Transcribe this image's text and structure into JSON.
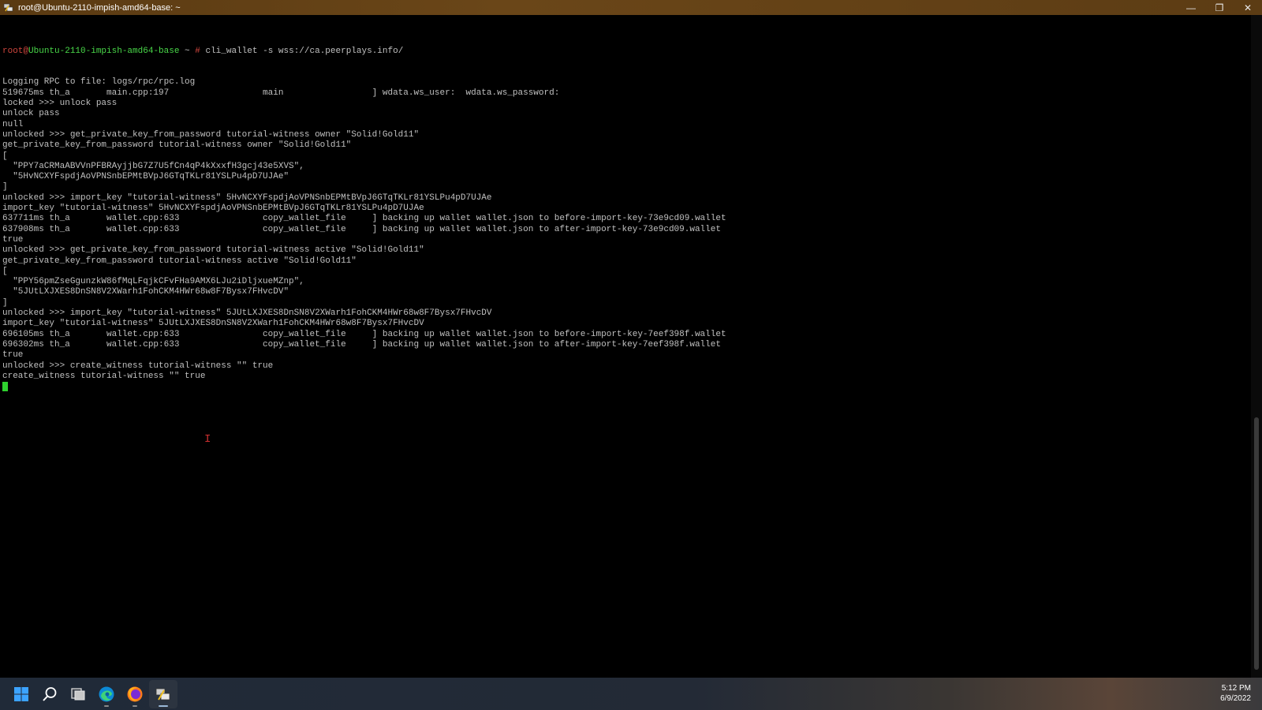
{
  "window": {
    "title": "root@Ubuntu-2110-impish-amd64-base: ~",
    "controls": {
      "minimize": "—",
      "maximize": "❐",
      "close": "✕"
    }
  },
  "prompt": {
    "user": "root",
    "at": "@",
    "host": "Ubuntu-2110-impish-amd64-base",
    "path": " ~ ",
    "symbol": "#",
    "command": " cli_wallet -s wss://ca.peerplays.info/"
  },
  "terminal_lines": [
    "Logging RPC to file: logs/rpc/rpc.log",
    "519675ms th_a       main.cpp:197                  main                 ] wdata.ws_user:  wdata.ws_password:",
    "locked >>> unlock pass",
    "unlock pass",
    "null",
    "unlocked >>> get_private_key_from_password tutorial-witness owner \"Solid!Gold11\"",
    "get_private_key_from_password tutorial-witness owner \"Solid!Gold11\"",
    "[",
    "  \"PPY7aCRMaABVVnPFBRAyjjbG7Z7U5fCn4qP4kXxxfH3gcj43e5XVS\",",
    "  \"5HvNCXYFspdjAoVPNSnbEPMtBVpJ6GTqTKLr81YSLPu4pD7UJAe\"",
    "]",
    "unlocked >>> import_key \"tutorial-witness\" 5HvNCXYFspdjAoVPNSnbEPMtBVpJ6GTqTKLr81YSLPu4pD7UJAe",
    "import_key \"tutorial-witness\" 5HvNCXYFspdjAoVPNSnbEPMtBVpJ6GTqTKLr81YSLPu4pD7UJAe",
    "637711ms th_a       wallet.cpp:633                copy_wallet_file     ] backing up wallet wallet.json to before-import-key-73e9cd09.wallet",
    "637908ms th_a       wallet.cpp:633                copy_wallet_file     ] backing up wallet wallet.json to after-import-key-73e9cd09.wallet",
    "true",
    "unlocked >>> get_private_key_from_password tutorial-witness active \"Solid!Gold11\"",
    "get_private_key_from_password tutorial-witness active \"Solid!Gold11\"",
    "[",
    "  \"PPY56pmZseGgunzkW86fMqLFqjkCFvFHa9AMX6LJu2iDljxueMZnp\",",
    "  \"5JUtLXJXES8DnSN8V2XWarh1FohCKM4HWr68w8F7Bysx7FHvcDV\"",
    "]",
    "unlocked >>> import_key \"tutorial-witness\" 5JUtLXJXES8DnSN8V2XWarh1FohCKM4HWr68w8F7Bysx7FHvcDV",
    "import_key \"tutorial-witness\" 5JUtLXJXES8DnSN8V2XWarh1FohCKM4HWr68w8F7Bysx7FHvcDV",
    "696105ms th_a       wallet.cpp:633                copy_wallet_file     ] backing up wallet wallet.json to before-import-key-7eef398f.wallet",
    "696302ms th_a       wallet.cpp:633                copy_wallet_file     ] backing up wallet wallet.json to after-import-key-7eef398f.wallet",
    "true",
    "unlocked >>> create_witness tutorial-witness \"\" true",
    "create_witness tutorial-witness \"\" true"
  ],
  "taskbar": {
    "items": [
      "windows-start-icon",
      "search-icon",
      "task-view-icon",
      "edge-icon",
      "firefox-icon",
      "putty-icon"
    ],
    "time": "5:12 PM",
    "date": "6/9/2022"
  },
  "colors": {
    "prompt_user": "#d0463e",
    "prompt_host": "#49d849",
    "terminal_text": "#c0c0c0",
    "cursor": "#2fd22f",
    "titlebar": "#5a3a12"
  }
}
